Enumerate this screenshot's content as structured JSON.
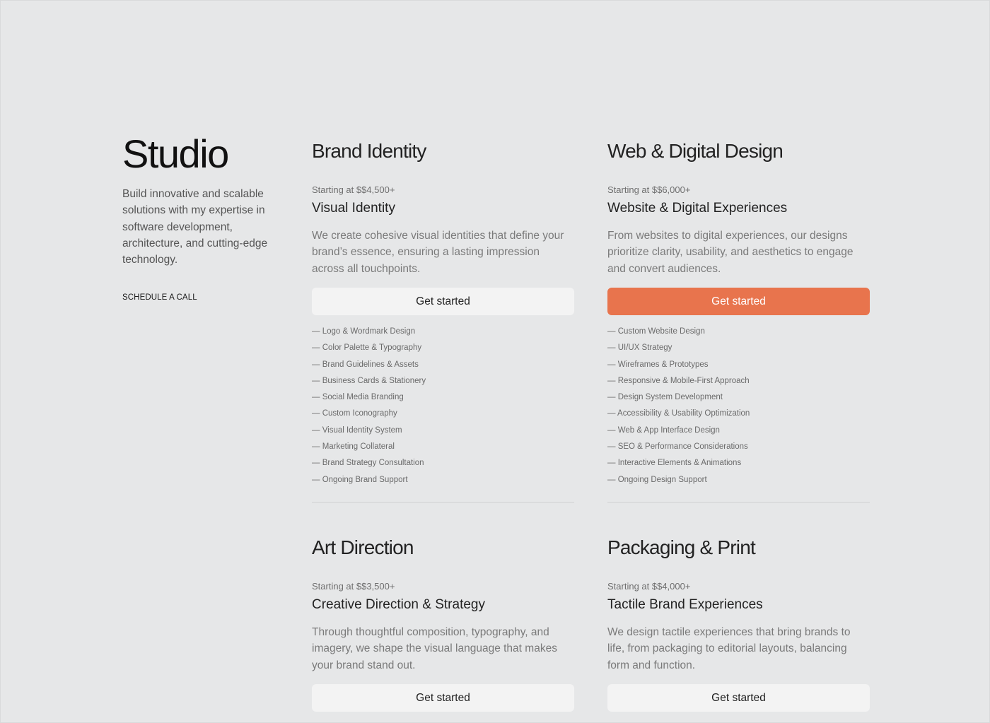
{
  "intro": {
    "title": "Studio",
    "description": "Build innovative and scalable solutions with my expertise in software development, architecture, and cutting-edge technology.",
    "cta_label": "SCHEDULE A CALL"
  },
  "services": [
    {
      "title": "Brand Identity",
      "price": "Starting at $$4,500+",
      "subtitle": "Visual Identity",
      "description": "We create cohesive visual identities that define your brand’s essence, ensuring a lasting impression across all touchpoints.",
      "cta_label": "Get started",
      "features": [
        "— Logo & Wordmark Design",
        "— Color Palette & Typography",
        "— Brand Guidelines & Assets",
        "— Business Cards & Stationery",
        "— Social Media Branding",
        "— Custom Iconography",
        "— Visual Identity System",
        "— Marketing Collateral",
        "— Brand Strategy Consultation",
        "— Ongoing Brand Support"
      ]
    },
    {
      "title": "Web & Digital Design",
      "price": "Starting at $$6,000+",
      "subtitle": "Website & Digital Experiences",
      "description": "From websites to digital experiences, our designs prioritize clarity, usability, and aesthetics to engage and convert audiences.",
      "cta_label": "Get started",
      "features": [
        "— Custom Website Design",
        "— UI/UX Strategy",
        "— Wireframes & Prototypes",
        "— Responsive & Mobile-First Approach",
        "— Design System Development",
        "— Accessibility & Usability Optimization",
        "— Web & App Interface Design",
        "— SEO & Performance Considerations",
        "— Interactive Elements & Animations",
        "— Ongoing Design Support"
      ]
    },
    {
      "title": "Art Direction",
      "price": "Starting at $$3,500+",
      "subtitle": "Creative Direction & Strategy",
      "description": "Through thoughtful composition, typography, and imagery, we shape the visual language that makes your brand stand out.",
      "cta_label": "Get started"
    },
    {
      "title": "Packaging & Print",
      "price": "Starting at $$4,000+",
      "subtitle": "Tactile Brand Experiences",
      "description": "We design tactile experiences that bring brands to life, from packaging to editorial layouts, balancing form and function.",
      "cta_label": "Get started"
    }
  ],
  "colors": {
    "background": "#e6e7e8",
    "accent": "#e8744d",
    "button_neutral": "#f3f3f3"
  }
}
